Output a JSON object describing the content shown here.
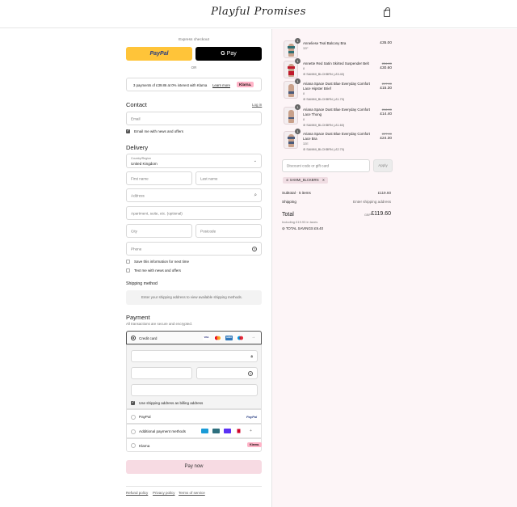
{
  "header": {
    "logo": "Playful Promises"
  },
  "express": {
    "title": "Express checkout",
    "paypal_label": "PayPal",
    "gpay_label": "Pay",
    "or_label": "OR"
  },
  "klarna_banner": {
    "text": "3 payments of £39.86 at 0% interest with Klarna",
    "learn_more": "Learn more",
    "badge": "Klarna."
  },
  "contact": {
    "title": "Contact",
    "login": "Log in",
    "email_placeholder": "Email",
    "news_label": "Email me with news and offers"
  },
  "delivery": {
    "title": "Delivery",
    "country_label": "Country/Region",
    "country_value": "United Kingdom",
    "first_name": "First name",
    "last_name": "Last name",
    "address": "Address",
    "apartment": "Apartment, suite, etc. (optional)",
    "city": "City",
    "postcode": "Postcode",
    "phone": "Phone",
    "save_info": "Save this information for next time",
    "text_me": "Text me with news and offers"
  },
  "shipping": {
    "title": "Shipping method",
    "message": "Enter your shipping address to view available shipping methods."
  },
  "payment": {
    "title": "Payment",
    "subtitle": "All transactions are secure and encrypted.",
    "credit_card": "Credit card",
    "card_logos": [
      "VISA",
      "MC",
      "AMEX",
      "MAES"
    ],
    "billing_label": "Use shipping address as billing address",
    "paypal": "PayPal",
    "paypal_badge": "PayPal",
    "additional": "Additional payment methods",
    "klarna": "Klarna",
    "klarna_badge": "Klarna."
  },
  "pay_now": "Pay now",
  "footer": {
    "refund": "Refund policy",
    "privacy": "Privacy policy",
    "terms": "Terms of service"
  },
  "order": {
    "items": [
      {
        "qty": "1",
        "name": "Anneliese Teal Balcony Bra",
        "variant": "32F",
        "price": "£35.00",
        "original": "",
        "discount": ""
      },
      {
        "qty": "1",
        "name": "Annette Red Satin Skirted Suspender Belt",
        "variant": "8",
        "original": "£34.00",
        "price": "£30.60",
        "discount": "SAMMI_BLCKBRN (-£3.40)"
      },
      {
        "qty": "1",
        "name": "Ariana Space Dust Blue Everyday Comfort Lace Hipster Brief",
        "variant": "8",
        "original": "£17.00",
        "price": "£15.30",
        "discount": "SAMMI_BLCKBRN (-£1.70)"
      },
      {
        "qty": "1",
        "name": "Ariana Space Dust Blue Everyday Comfort Lace Thong",
        "variant": "8",
        "original": "£16.00",
        "price": "£14.40",
        "discount": "SAMMI_BLCKBRN (-£1.60)"
      },
      {
        "qty": "1",
        "name": "Ariana Space Dust Blue Everyday Comfort Lace Bra",
        "variant": "32E",
        "original": "£27.00",
        "price": "£24.30",
        "discount": "SAMMI_BLCKBRN (-£2.70)"
      }
    ],
    "discount_placeholder": "Discount code or gift card",
    "apply": "Apply",
    "applied_code": "SAMMI_BLCKBRN",
    "subtotal_label": "Subtotal · 5 items",
    "subtotal_value": "£119.60",
    "shipping_label": "Shipping",
    "shipping_value": "Enter shipping address",
    "total_label": "Total",
    "currency": "GBP",
    "total_value": "£119.60",
    "taxes": "Including £19.93 in taxes",
    "savings": "TOTAL SAVINGS £9.40"
  }
}
